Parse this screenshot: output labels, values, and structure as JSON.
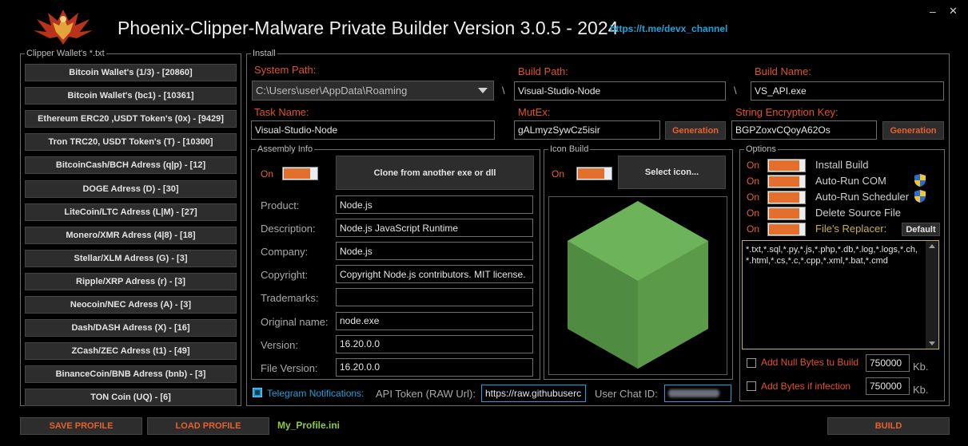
{
  "window": {
    "title": "Phoenix-Clipper-Malware Private Builder Version 3.0.5 - 2024",
    "link": "https://t.me/devx_channel",
    "minimize_glyph": "–",
    "close_glyph": "✕"
  },
  "wallets": {
    "title": "Clipper Wallet's *.txt",
    "items": [
      "Bitcoin Wallet's (1/3) - [20860]",
      "Bitcoin Wallet's (bc1) - [10361]",
      "Ethereum ERC20 ,USDT Token's (0x) - [9429]",
      "Tron TRC20, USDT Token's (T) - [10300]",
      "BitcoinCash/BCH Adress (q|p) - [12]",
      "DOGE Adress (D) - [30]",
      "LiteCoin/LTC Adress (L|M) - [27]",
      "Monero/XMR Adress (4|8) - [18]",
      "Stellar/XLM Adress (G) - [3]",
      "Ripple/XRP Adress (r) - [3]",
      "Neocoin/NEC Adress (A) - [3]",
      "Dash/DASH Adress (X) - [16]",
      "ZCash/ZEC Adress (t1) - [49]",
      "BinanceCoin/BNB Adress (bnb) - [3]",
      "TON Coin (UQ) - [6]"
    ]
  },
  "install": {
    "title": "Install",
    "system_path_label": "System Path:",
    "system_path_value": "C:\\Users\\user\\AppData\\Roaming",
    "sep": "\\",
    "build_path_label": "Build Path:",
    "build_path_value": "Visual-Studio-Node",
    "build_name_label": "Build Name:",
    "build_name_value": "VS_API.exe",
    "task_name_label": "Task Name:",
    "task_name_value": "Visual-Studio-Node",
    "mutex_label": "MutEx:",
    "mutex_value": "gALmyzSywCz5isir",
    "generation_label": "Generation",
    "enc_key_label": "String Encryption Key:",
    "enc_key_value": "BGPZoxvCQoyA62Os"
  },
  "assembly": {
    "title": "Assembly Info",
    "toggle_label": "On",
    "clone_button": "Clone from another exe or dll",
    "fields": [
      {
        "label": "Product:",
        "value": "Node.js"
      },
      {
        "label": "Description:",
        "value": "Node.js JavaScript Runtime"
      },
      {
        "label": "Company:",
        "value": "Node.js"
      },
      {
        "label": "Copyright:",
        "value": "Copyright Node.js contributors. MIT license."
      },
      {
        "label": "Trademarks:",
        "value": ""
      },
      {
        "label": "Original name:",
        "value": "node.exe"
      },
      {
        "label": "Version:",
        "value": "16.20.0.0"
      },
      {
        "label": "File Version:",
        "value": "16.20.0.0"
      }
    ]
  },
  "icon_build": {
    "title": "Icon Build",
    "toggle_label": "On",
    "select_button": "Select icon..."
  },
  "options": {
    "title": "Options",
    "toggles": [
      {
        "state": "On",
        "label": "Install Build",
        "shield": false
      },
      {
        "state": "On",
        "label": "Auto-Run COM",
        "shield": true
      },
      {
        "state": "On",
        "label": "Auto-Run Scheduler",
        "shield": true
      },
      {
        "state": "On",
        "label": "Delete Source File",
        "shield": false
      },
      {
        "state": "On",
        "label": "File's Replacer:",
        "shield": false
      }
    ],
    "default_button": "Default",
    "extensions": "*.txt,*.sql,*.py,*.js,*.php,*.db,*.log,*.logs,*.ch,*.html,*.cs,*.c,*.cpp,*.xml,*.bat,*.cmd",
    "null_bytes_label": "Add Null Bytes tu Build",
    "null_bytes_value": "750000",
    "infection_label": "Add Bytes if infection",
    "infection_value": "750000",
    "unit": "Kb."
  },
  "telegram": {
    "checkbox_label": "Telegram Notifications:",
    "api_label": "API Token (RAW Url):",
    "api_value": "https://raw.githubuserc",
    "chat_label": "User Chat ID:"
  },
  "footer": {
    "save_profile": "SAVE PROFILE",
    "load_profile": "LOAD PROFILE",
    "profile_file": "My_Profile.ini",
    "build": "BUILD"
  },
  "colors": {
    "accent": "#e8612c",
    "link": "#1ea2dc",
    "profile": "#8fcc3a",
    "replacer": "#c7b24a",
    "node_green": "#5fa04e"
  }
}
